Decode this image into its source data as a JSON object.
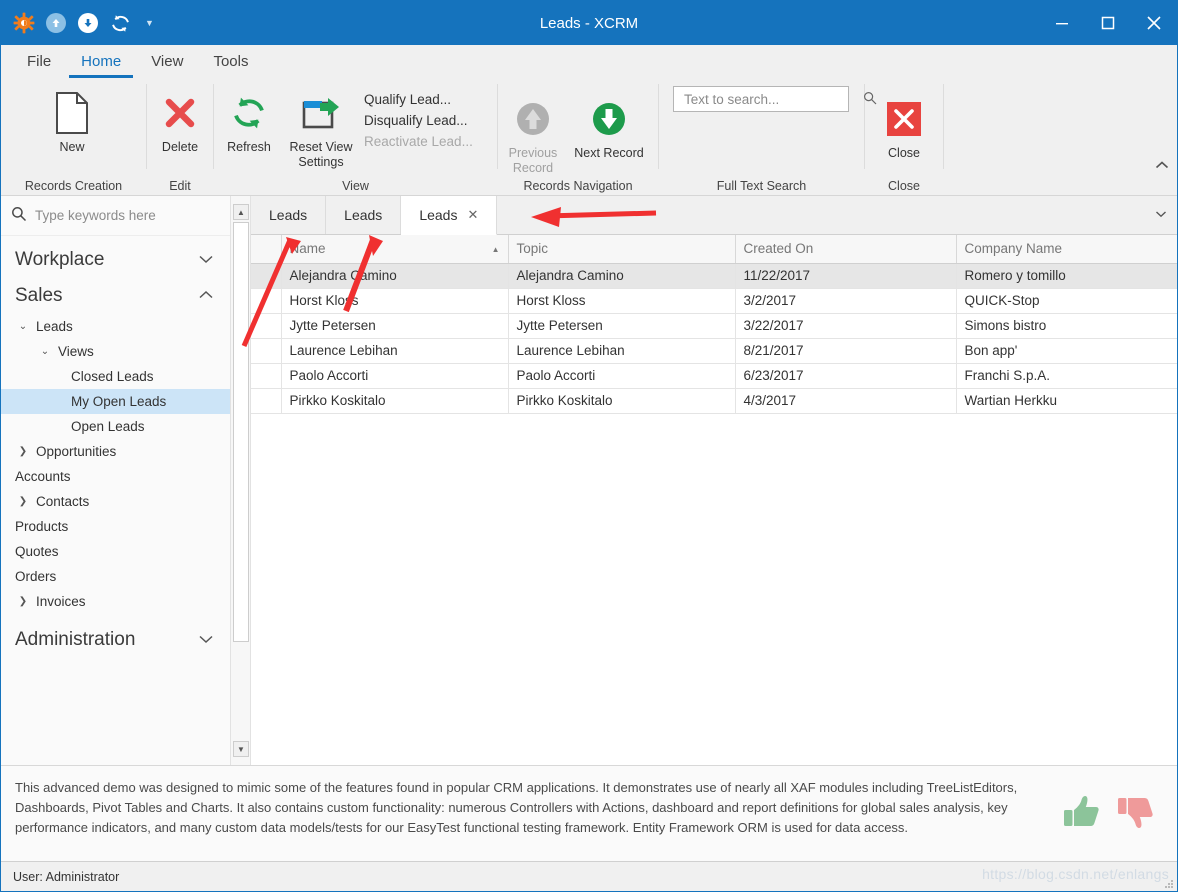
{
  "window": {
    "title": "Leads - XCRM",
    "quick_access": [
      "app-gear-icon",
      "upload-icon",
      "download-icon",
      "refresh-icon",
      "dropdown-caret"
    ],
    "controls": {
      "minimize": "minimize",
      "maximize": "maximize",
      "close": "close"
    },
    "accent_color": "#1573bd"
  },
  "ribbon": {
    "tabs": [
      {
        "label": "File",
        "active": false
      },
      {
        "label": "Home",
        "active": true
      },
      {
        "label": "View",
        "active": false
      },
      {
        "label": "Tools",
        "active": false
      }
    ],
    "groups": [
      {
        "title": "Records Creation",
        "buttons": [
          {
            "label": "New",
            "icon": "new-document-icon",
            "disabled": false
          }
        ]
      },
      {
        "title": "Edit",
        "buttons": [
          {
            "label": "Delete",
            "icon": "delete-x-icon",
            "disabled": false
          }
        ]
      },
      {
        "title": "View",
        "buttons": [
          {
            "label": "Refresh",
            "icon": "refresh-icon",
            "disabled": false
          },
          {
            "label": "Reset View Settings",
            "icon": "reset-view-icon",
            "disabled": false
          }
        ],
        "menu_items": [
          {
            "label": "Qualify Lead...",
            "disabled": false
          },
          {
            "label": "Disqualify Lead...",
            "disabled": false
          },
          {
            "label": "Reactivate Lead...",
            "disabled": true
          }
        ]
      },
      {
        "title": "Records Navigation",
        "buttons": [
          {
            "label": "Previous Record",
            "icon": "arrow-up-circle-icon",
            "disabled": true
          },
          {
            "label": "Next Record",
            "icon": "arrow-down-circle-icon",
            "disabled": false
          }
        ]
      },
      {
        "title": "Full Text Search",
        "search": {
          "value": "",
          "placeholder": "Text to search...",
          "icon": "search-icon"
        }
      },
      {
        "title": "Close",
        "buttons": [
          {
            "label": "Close",
            "icon": "close-x-icon",
            "disabled": false
          }
        ]
      }
    ],
    "collapse_icon": "chevron-up-icon"
  },
  "navigation": {
    "search_placeholder": "Type keywords here",
    "search_icon": "search-icon",
    "items": [
      {
        "label": "Workplace",
        "level": "group",
        "chevron": "chevron-down",
        "selected": false
      },
      {
        "label": "Sales",
        "level": "group",
        "chevron": "chevron-up",
        "selected": false
      },
      {
        "label": "Leads",
        "level": "l1",
        "chevron": "chevron-down",
        "selected": false
      },
      {
        "label": "Views",
        "level": "l2",
        "chevron": "chevron-down",
        "selected": false
      },
      {
        "label": "Closed Leads",
        "level": "l3",
        "chevron": "",
        "selected": false
      },
      {
        "label": "My Open Leads",
        "level": "l3",
        "chevron": "",
        "selected": true
      },
      {
        "label": "Open Leads",
        "level": "l3",
        "chevron": "",
        "selected": false
      },
      {
        "label": "Opportunities",
        "level": "l1",
        "chevron": "chevron-right",
        "selected": false
      },
      {
        "label": "Accounts",
        "level": "l1-nochev",
        "chevron": "",
        "selected": false
      },
      {
        "label": "Contacts",
        "level": "l1",
        "chevron": "chevron-right",
        "selected": false
      },
      {
        "label": "Products",
        "level": "l1-nochev",
        "chevron": "",
        "selected": false
      },
      {
        "label": "Quotes",
        "level": "l1-nochev",
        "chevron": "",
        "selected": false
      },
      {
        "label": "Orders",
        "level": "l1-nochev",
        "chevron": "",
        "selected": false
      },
      {
        "label": "Invoices",
        "level": "l1",
        "chevron": "chevron-right",
        "selected": false
      },
      {
        "label": "Administration",
        "level": "group",
        "chevron": "chevron-down",
        "selected": false
      }
    ],
    "scrollbar": {
      "up_icon": "scroll-up-arrow",
      "down_icon": "scroll-down-arrow"
    }
  },
  "document_tabs": [
    {
      "label": "Leads",
      "active": false,
      "closable": false
    },
    {
      "label": "Leads",
      "active": false,
      "closable": false
    },
    {
      "label": "Leads",
      "active": true,
      "closable": true,
      "close_icon": "close-icon"
    }
  ],
  "document_tabs_overflow_icon": "chevron-down-icon",
  "grid": {
    "columns": [
      {
        "label": "Name",
        "sorted": "asc",
        "sort_icon": "sort-ascending-arrow"
      },
      {
        "label": "Topic",
        "sorted": ""
      },
      {
        "label": "Created On",
        "sorted": ""
      },
      {
        "label": "Company Name",
        "sorted": ""
      }
    ],
    "rows": [
      {
        "focused": true,
        "cells": [
          "Alejandra Camino",
          "Alejandra Camino",
          "11/22/2017",
          "Romero y tomillo"
        ]
      },
      {
        "focused": false,
        "cells": [
          "Horst Kloss",
          "Horst Kloss",
          "3/2/2017",
          "QUICK-Stop"
        ]
      },
      {
        "focused": false,
        "cells": [
          "Jytte Petersen",
          "Jytte Petersen",
          "3/22/2017",
          "Simons bistro"
        ]
      },
      {
        "focused": false,
        "cells": [
          "Laurence Lebihan",
          "Laurence Lebihan",
          "8/21/2017",
          "Bon app'"
        ]
      },
      {
        "focused": false,
        "cells": [
          "Paolo Accorti",
          "Paolo Accorti",
          "6/23/2017",
          "Franchi S.p.A."
        ]
      },
      {
        "focused": false,
        "cells": [
          "Pirkko Koskitalo",
          "Pirkko Koskitalo",
          "4/3/2017",
          "Wartian Herkku"
        ]
      }
    ]
  },
  "description": {
    "text": "This advanced demo was designed to mimic some of the features found in popular CRM applications. It demonstrates use of nearly all XAF modules including TreeListEditors, Dashboards, Pivot Tables and Charts. It also contains custom functionality: numerous Controllers with Actions, dashboard and report definitions for global sales analysis, key performance indicators, and many custom data models/tests for our EasyTest functional testing framework. Entity Framework ORM is used for data access.",
    "rating": {
      "like_icon": "thumbs-up-icon",
      "like_color": "#8cc49a",
      "dislike_icon": "thumbs-down-icon",
      "dislike_color": "#ef9a9a"
    }
  },
  "status": {
    "user": "User: Administrator",
    "watermark": "https://blog.csdn.net/enlangs"
  },
  "annotations": {
    "arrow_color": "#f03030",
    "arrows": [
      "arrow-to-tab-1",
      "arrow-to-tab-2",
      "arrow-to-tab-strip"
    ]
  }
}
